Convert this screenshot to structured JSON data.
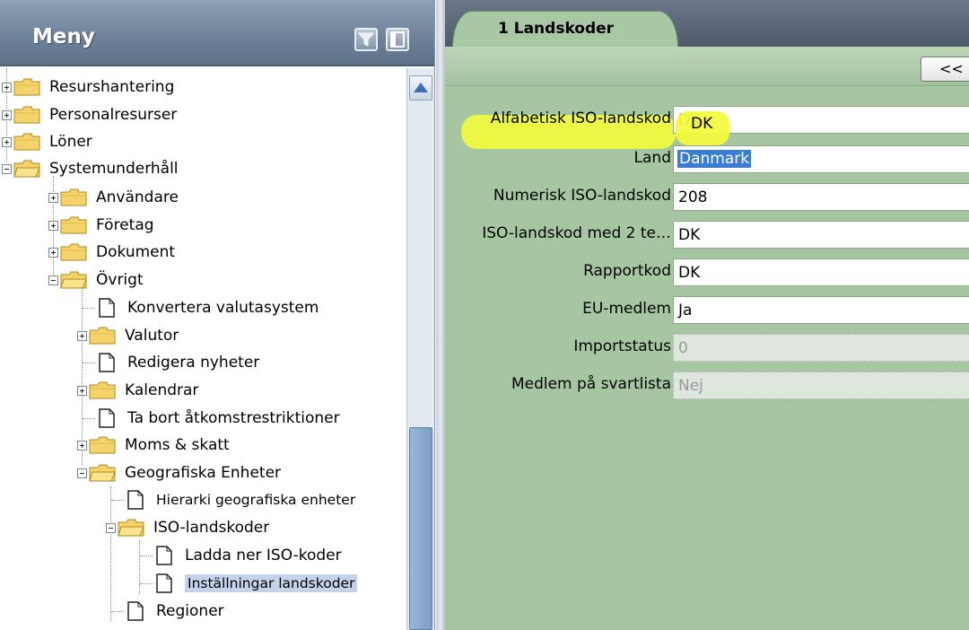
{
  "menu": {
    "title": "Meny",
    "tree": {
      "resurshantering": "Resurshantering",
      "personalresurser": "Personalresurser",
      "loner": "Löner",
      "systemunderhall": "Systemunderhåll",
      "anvandare": "Användare",
      "foretag": "Företag",
      "dokument": "Dokument",
      "ovrigt": "Övrigt",
      "konvertera": "Konvertera valutasystem",
      "valutor": "Valutor",
      "redigera_nyheter": "Redigera nyheter",
      "kalendrar": "Kalendrar",
      "ta_bort": "Ta bort åtkomstrestriktioner",
      "moms": "Moms & skatt",
      "geografiska": "Geografiska Enheter",
      "hierarki": "Hierarki geografiska enheter",
      "iso_landskoder": "ISO-landskoder",
      "ladda_ner": "Ladda ner ISO-koder",
      "installningar": "Inställningar landskoder",
      "regioner": "Regioner"
    }
  },
  "tabs": {
    "landskoder": "1 Landskoder"
  },
  "toolbar": {
    "prev_label": "<<"
  },
  "form": {
    "alfabetisk_label": "Alfabetisk ISO-landskod",
    "alfabetisk_value": "DK",
    "land_label": "Land",
    "land_value": "Danmark",
    "numerisk_label": "Numerisk ISO-landskod",
    "numerisk_value": "208",
    "iso2_label": "ISO-landskod med 2 te…",
    "iso2_value": "DK",
    "rapportkod_label": "Rapportkod",
    "rapportkod_value": "DK",
    "eu_label": "EU-medlem",
    "eu_value": "Ja",
    "importstatus_label": "Importstatus",
    "importstatus_value": "0",
    "svartlista_label": "Medlem på svartlista",
    "svartlista_value": "Nej"
  },
  "colors": {
    "menu_header": "#6f849b",
    "content_bg": "#a5c6a0",
    "selection": "#3a7dd6",
    "highlight": "#f2fa3d"
  }
}
